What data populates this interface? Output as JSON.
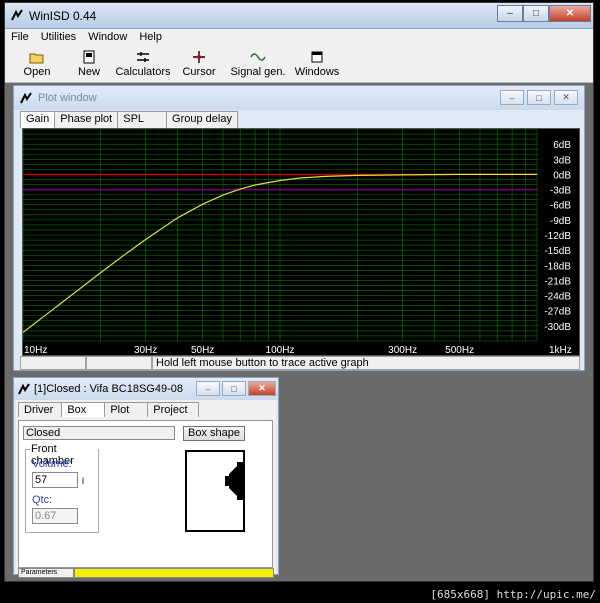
{
  "app": {
    "title": "WinISD 0.44",
    "caption_min": "–",
    "caption_max": "□",
    "caption_close": "✕"
  },
  "menu": [
    "File",
    "Utilities",
    "Window",
    "Help"
  ],
  "toolbar": [
    {
      "label": "Open",
      "icon": "folder-icon"
    },
    {
      "label": "New",
      "icon": "new-project-icon"
    },
    {
      "label": "Calculators",
      "icon": "calculators-icon"
    },
    {
      "label": "Cursor",
      "icon": "cursor-icon"
    },
    {
      "label": "Signal gen.",
      "icon": "signal-generator-icon"
    },
    {
      "label": "Windows",
      "icon": "windows-icon"
    }
  ],
  "plot_window": {
    "title": "Plot window",
    "tabs": [
      "Gain",
      "Phase plot",
      "SPL",
      "Group delay"
    ],
    "active_tab": "Gain",
    "status": [
      "",
      "",
      "Hold left mouse button to trace active graph"
    ]
  },
  "chart_data": {
    "type": "line",
    "x_scale": "log",
    "xlim": [
      10,
      1000
    ],
    "ylim": [
      -33,
      9
    ],
    "y_ticks": [
      "6dB",
      "3dB",
      "0dB",
      "-3dB",
      "-6dB",
      "-9dB",
      "-12dB",
      "-15dB",
      "-18dB",
      "-21dB",
      "-24dB",
      "-27dB",
      "-30dB"
    ],
    "y_tick_values": [
      6,
      3,
      0,
      -3,
      -6,
      -9,
      -12,
      -15,
      -18,
      -21,
      -24,
      -27,
      -30
    ],
    "x_ticks": [
      "10Hz",
      "30Hz",
      "50Hz",
      "100Hz",
      "300Hz",
      "500Hz",
      "1kHz"
    ],
    "x_tick_values": [
      10,
      30,
      50,
      100,
      300,
      500,
      1000
    ],
    "ref_lines": [
      {
        "y": 0,
        "color": "#c00000"
      },
      {
        "y": -3,
        "color": "#800080"
      }
    ],
    "series": [
      {
        "color": "#e0e040",
        "x": [
          10,
          12,
          15,
          20,
          25,
          30,
          40,
          50,
          60,
          70,
          80,
          100,
          120,
          150,
          200,
          300,
          500,
          1000
        ],
        "y": [
          -31.3,
          -28.2,
          -24.4,
          -19.5,
          -15.8,
          -12.9,
          -8.6,
          -5.9,
          -4.1,
          -2.9,
          -2.1,
          -1.2,
          -0.7,
          -0.4,
          -0.2,
          -0.1,
          0,
          0
        ]
      }
    ],
    "grid": true,
    "background": "#000000",
    "grid_color": "#00a000"
  },
  "closed_window": {
    "title": "[1]Closed : Vifa BC18SG49-08",
    "tabs": [
      "Driver",
      "Box",
      "Plot",
      "Project"
    ],
    "active_tab": "Box",
    "box_type": "Closed",
    "box_shape_label": "Box shape",
    "front_chamber_label": "Front chamber",
    "volume_label": "Volume:",
    "volume_value": "57",
    "volume_unit": "l",
    "qtc_label": "Qtc:",
    "qtc_value": "0.67",
    "status_label": "Parameters"
  },
  "watermark": "[685x668] http://upic.me/"
}
